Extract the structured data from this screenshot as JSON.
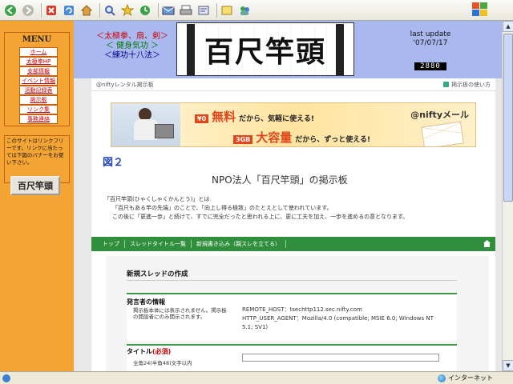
{
  "toolbar": {
    "buttons": [
      "back-icon",
      "forward-icon",
      "stop-icon",
      "refresh-icon",
      "home-icon",
      "search-icon",
      "favorites-icon",
      "history-icon",
      "mail-icon",
      "print-icon",
      "edit-icon",
      "discuss-icon",
      "messenger-icon"
    ]
  },
  "sidebar": {
    "menu_title": "MENU",
    "items": [
      "ホーム",
      "太極拳HP",
      "支部情報",
      "イベント情報",
      "活動記録表",
      "掲示板",
      "リンク集",
      "事務連絡"
    ],
    "note": "このサイトはリンクフリーです。リンクに当たっては下図のバナーをお使い下さい。",
    "banner": "百尺竿頭"
  },
  "header": {
    "line1": "＜太極拳、扇、剣＞",
    "line2": "＜ 健身気功 ＞",
    "line3": "＜練功十八法＞",
    "logo": "百尺竿頭",
    "update_label": "last update",
    "update_date": "'07/07/17",
    "counter": "2880"
  },
  "board": {
    "site": "@niftyレンタル掲示板",
    "help": "掲示板の使い方",
    "ad": {
      "price_badge": "¥0",
      "free": "無料",
      "free_text": "だから、気軽に使える!",
      "gb_badge": "3GB",
      "big": "大容量",
      "big_text": "だから、ずっと使える!",
      "brand": "@niftyメール"
    },
    "figure": "図２",
    "title": "NPO法人「百尺竿頭」の掲示板",
    "intro": [
      "「百尺竿頭(ひゃくしゃくかんとう)」とは",
      "「百尺もある竿の先端」のことで、「向上し得る極致」のたとえとして使われています。",
      "この後に「更進一歩」と続けて、すでに完全だったと思われる上に、更に工夫を加え、一歩を進めるの意となります。"
    ],
    "nav": [
      "トップ",
      "スレッドタイトル一覧",
      "新規書き込み（親スレを立てる）"
    ],
    "form": {
      "section_title": "新規スレッドの作成",
      "sender_head": "発言者の情報",
      "sender_note": "掲示板本体には表示されません。掲示板の開設者にのみ開示されます。",
      "remote_host": "REMOTE_HOST：tsechttp112.sec.nifty.com",
      "user_agent": "HTTP_USER_AGENT：Mozilla/4.0 (compatible; MSIE 6.0; Windows NT 5.1; SV1)",
      "title_head": "タイトル",
      "title_req": "(必須)",
      "title_note": "全角24(半角48)文字以内"
    }
  },
  "status": {
    "zone": "インターネット"
  }
}
